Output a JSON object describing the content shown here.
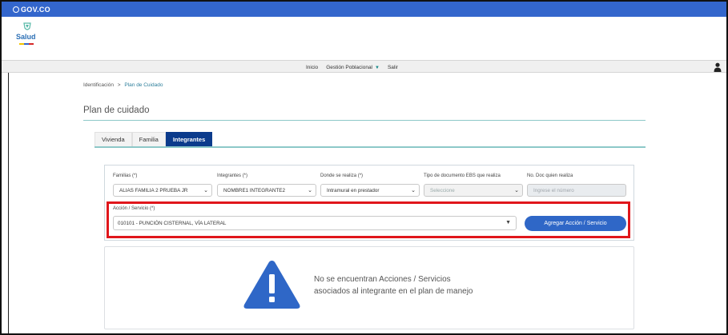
{
  "gov_bar": {
    "label": "GOV.CO"
  },
  "logo": {
    "text": "Salud"
  },
  "nav": {
    "items": [
      "Inicio",
      "Gestión Poblacional",
      "Salir"
    ]
  },
  "breadcrumb": {
    "first": "Identificación",
    "separator": ">",
    "current": "Plan de Cuidado"
  },
  "page_title": "Plan de cuidado",
  "tabs": [
    "Vivienda",
    "Familia",
    "Integrantes"
  ],
  "form": {
    "familias": {
      "label": "Familias (*)",
      "value": "ALIAS FAMILIA 2 PRUEBA JR"
    },
    "integrantes": {
      "label": "Integrantes (*)",
      "value": "NOMBRE1 INTEGRANTE2"
    },
    "donde": {
      "label": "Donde se realiza (*)",
      "value": "Intramural en prestador"
    },
    "tipo_doc": {
      "label": "Tipo de documento EBS que realiza",
      "value": "Seleccione"
    },
    "no_doc": {
      "label": "No. Doc quien realiza",
      "placeholder": "Ingrese el número"
    },
    "accion": {
      "label": "Acción / Servicio (*)",
      "value": "010101 - PUNCIÓN CISTERNAL, VÍA LATERAL"
    },
    "add_button": "Agregar Acción / Servicio"
  },
  "empty_state": {
    "line1": "No se encuentran Acciones / Servicios",
    "line2": "asociados al integrante en el plan de manejo"
  },
  "colors": {
    "gov_blue": "#3366cc",
    "tab_active": "#0b3b8c",
    "accent_teal": "#8dc8c8",
    "button_blue": "#2f67c7",
    "highlight_red": "#e0161b",
    "warning_icon": "#2f67c7"
  },
  "icons": [
    "gov-logo-icon",
    "salud-emblem-icon",
    "dropdown-triangle-icon",
    "user-icon",
    "chevron-down-icon",
    "warning-icon"
  ]
}
